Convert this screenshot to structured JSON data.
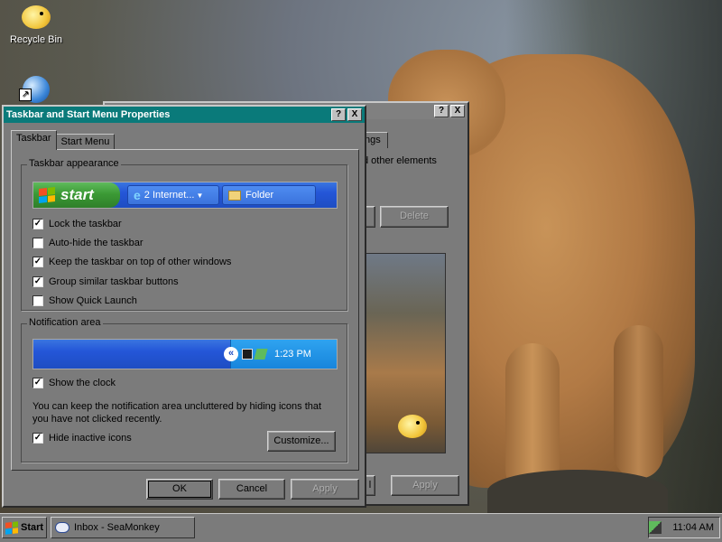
{
  "desktop": {
    "recycle_bin_label": "Recycle Bin"
  },
  "back_window": {
    "tab_fragment": "ngs",
    "text_fragment": "d other elements",
    "delete_label": "Delete",
    "ok_fragment": "l",
    "apply_label": "Apply"
  },
  "dialog": {
    "title": "Taskbar and Start Menu Properties",
    "help_btn": "?",
    "close_btn": "X",
    "tabs": [
      "Taskbar",
      "Start Menu"
    ],
    "appearance": {
      "legend": "Taskbar appearance",
      "preview": {
        "start_label": "start",
        "task1": "2 Internet...",
        "task2": "Folder"
      },
      "options": [
        {
          "label": "Lock the taskbar",
          "checked": true
        },
        {
          "label": "Auto-hide the taskbar",
          "checked": false
        },
        {
          "label": "Keep the taskbar on top of other windows",
          "checked": true
        },
        {
          "label": "Group similar taskbar buttons",
          "checked": true
        },
        {
          "label": "Show Quick Launch",
          "checked": false
        }
      ]
    },
    "notification": {
      "legend": "Notification area",
      "chevron": "«",
      "preview_time": "1:23 PM",
      "show_clock": {
        "label": "Show the clock",
        "checked": true
      },
      "description": "You can keep the notification area uncluttered by hiding icons that you have not clicked recently.",
      "hide_inactive": {
        "label": "Hide inactive icons",
        "checked": true
      },
      "customize_label": "Customize..."
    },
    "buttons": {
      "ok": "OK",
      "cancel": "Cancel",
      "apply": "Apply"
    }
  },
  "taskbar": {
    "start_label": "Start",
    "items": [
      {
        "label": "Inbox - SeaMonkey"
      }
    ],
    "clock": "11:04 AM"
  },
  "colors": {
    "title_active": "#0a7a7a",
    "title_inactive": "#808080",
    "chrome": "#7b7b7b",
    "xp_blue": "#2456d8",
    "xp_green": "#3b9a35"
  }
}
